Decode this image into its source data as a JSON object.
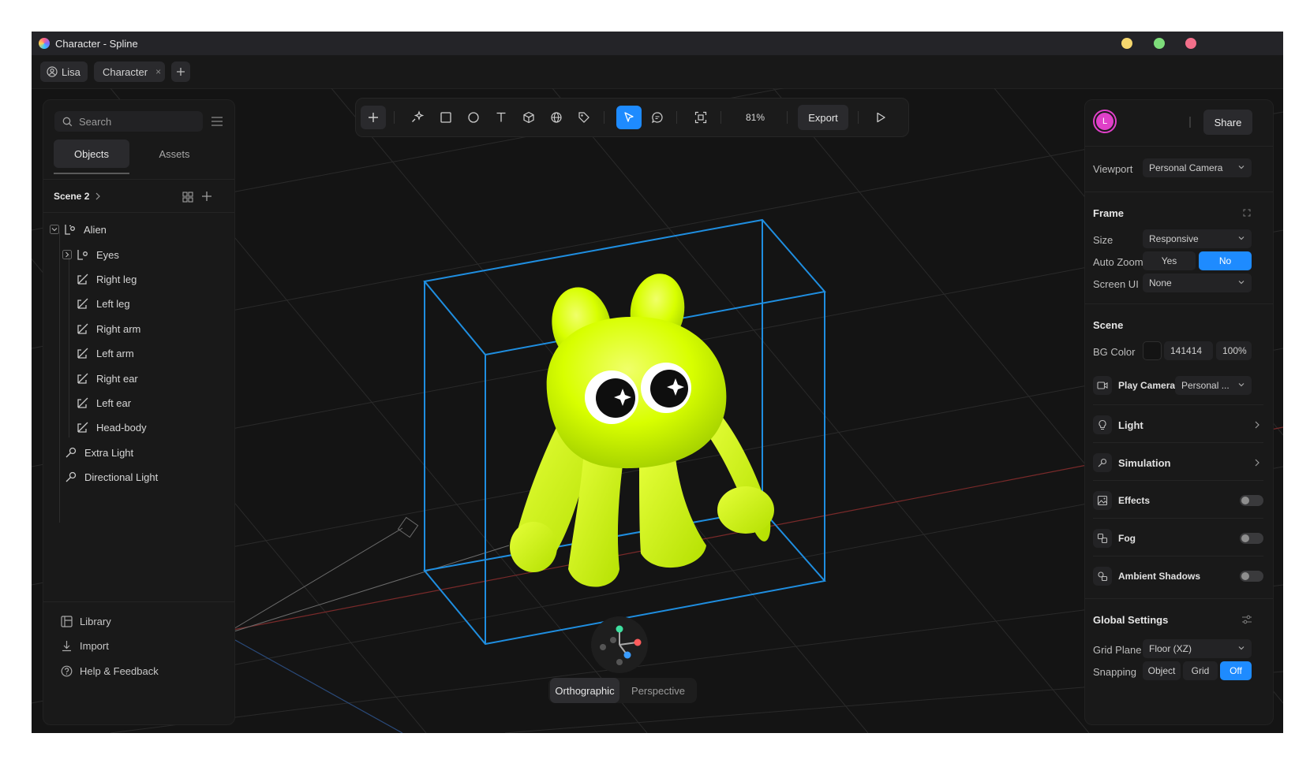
{
  "window": {
    "title": "Character - Spline"
  },
  "tabs": {
    "user": "Lisa",
    "document": "Character"
  },
  "left_panel": {
    "search_placeholder": "Search",
    "tabs": [
      "Objects",
      "Assets"
    ],
    "scene_name": "Scene 2",
    "tree": [
      {
        "label": "Alien",
        "type": "group",
        "level": 0
      },
      {
        "label": "Eyes",
        "type": "group",
        "level": 1
      },
      {
        "label": "Right leg",
        "type": "shape",
        "level": 1
      },
      {
        "label": "Left leg",
        "type": "shape",
        "level": 1
      },
      {
        "label": "Right arm",
        "type": "shape",
        "level": 1
      },
      {
        "label": "Left arm",
        "type": "shape",
        "level": 1
      },
      {
        "label": "Right ear",
        "type": "shape",
        "level": 1
      },
      {
        "label": "Left ear",
        "type": "shape",
        "level": 1
      },
      {
        "label": "Head-body",
        "type": "shape",
        "level": 1
      },
      {
        "label": "Extra Light",
        "type": "light",
        "level": 0
      },
      {
        "label": "Directional Light",
        "type": "light",
        "level": 0
      }
    ],
    "bottom_links": [
      "Library",
      "Import",
      "Help & Feedback"
    ]
  },
  "toolbar": {
    "zoom": "81%",
    "export_label": "Export"
  },
  "right_panel": {
    "avatar_initial": "L",
    "share_label": "Share",
    "viewport_label": "Viewport",
    "viewport_value": "Personal Camera",
    "frame": {
      "heading": "Frame",
      "size_label": "Size",
      "size_value": "Responsive",
      "autozoom_label": "Auto Zoom",
      "autozoom_yes": "Yes",
      "autozoom_no": "No",
      "screenui_label": "Screen UI",
      "screenui_value": "None"
    },
    "scene": {
      "heading": "Scene",
      "bg_label": "BG Color",
      "bg_hex": "141414",
      "bg_opacity": "100%",
      "play_camera_label": "Play Camera",
      "play_camera_value": "Personal ..."
    },
    "sections": [
      "Light",
      "Simulation"
    ],
    "toggles": [
      "Effects",
      "Fog",
      "Ambient Shadows"
    ],
    "global": {
      "heading": "Global Settings",
      "grid_label": "Grid Plane",
      "grid_value": "Floor (XZ)",
      "snapping_label": "Snapping",
      "snapping_options": [
        "Object",
        "Grid",
        "Off"
      ]
    }
  },
  "projection": [
    "Orthographic",
    "Perspective"
  ],
  "colors": {
    "accent": "#1e8bff",
    "character": "#d6ff00",
    "bbox": "#1f8ee0",
    "avatar": "#e040c8",
    "win_yellow": "#f5d76e",
    "win_green": "#7ddc7a",
    "win_red": "#f26f8a"
  }
}
